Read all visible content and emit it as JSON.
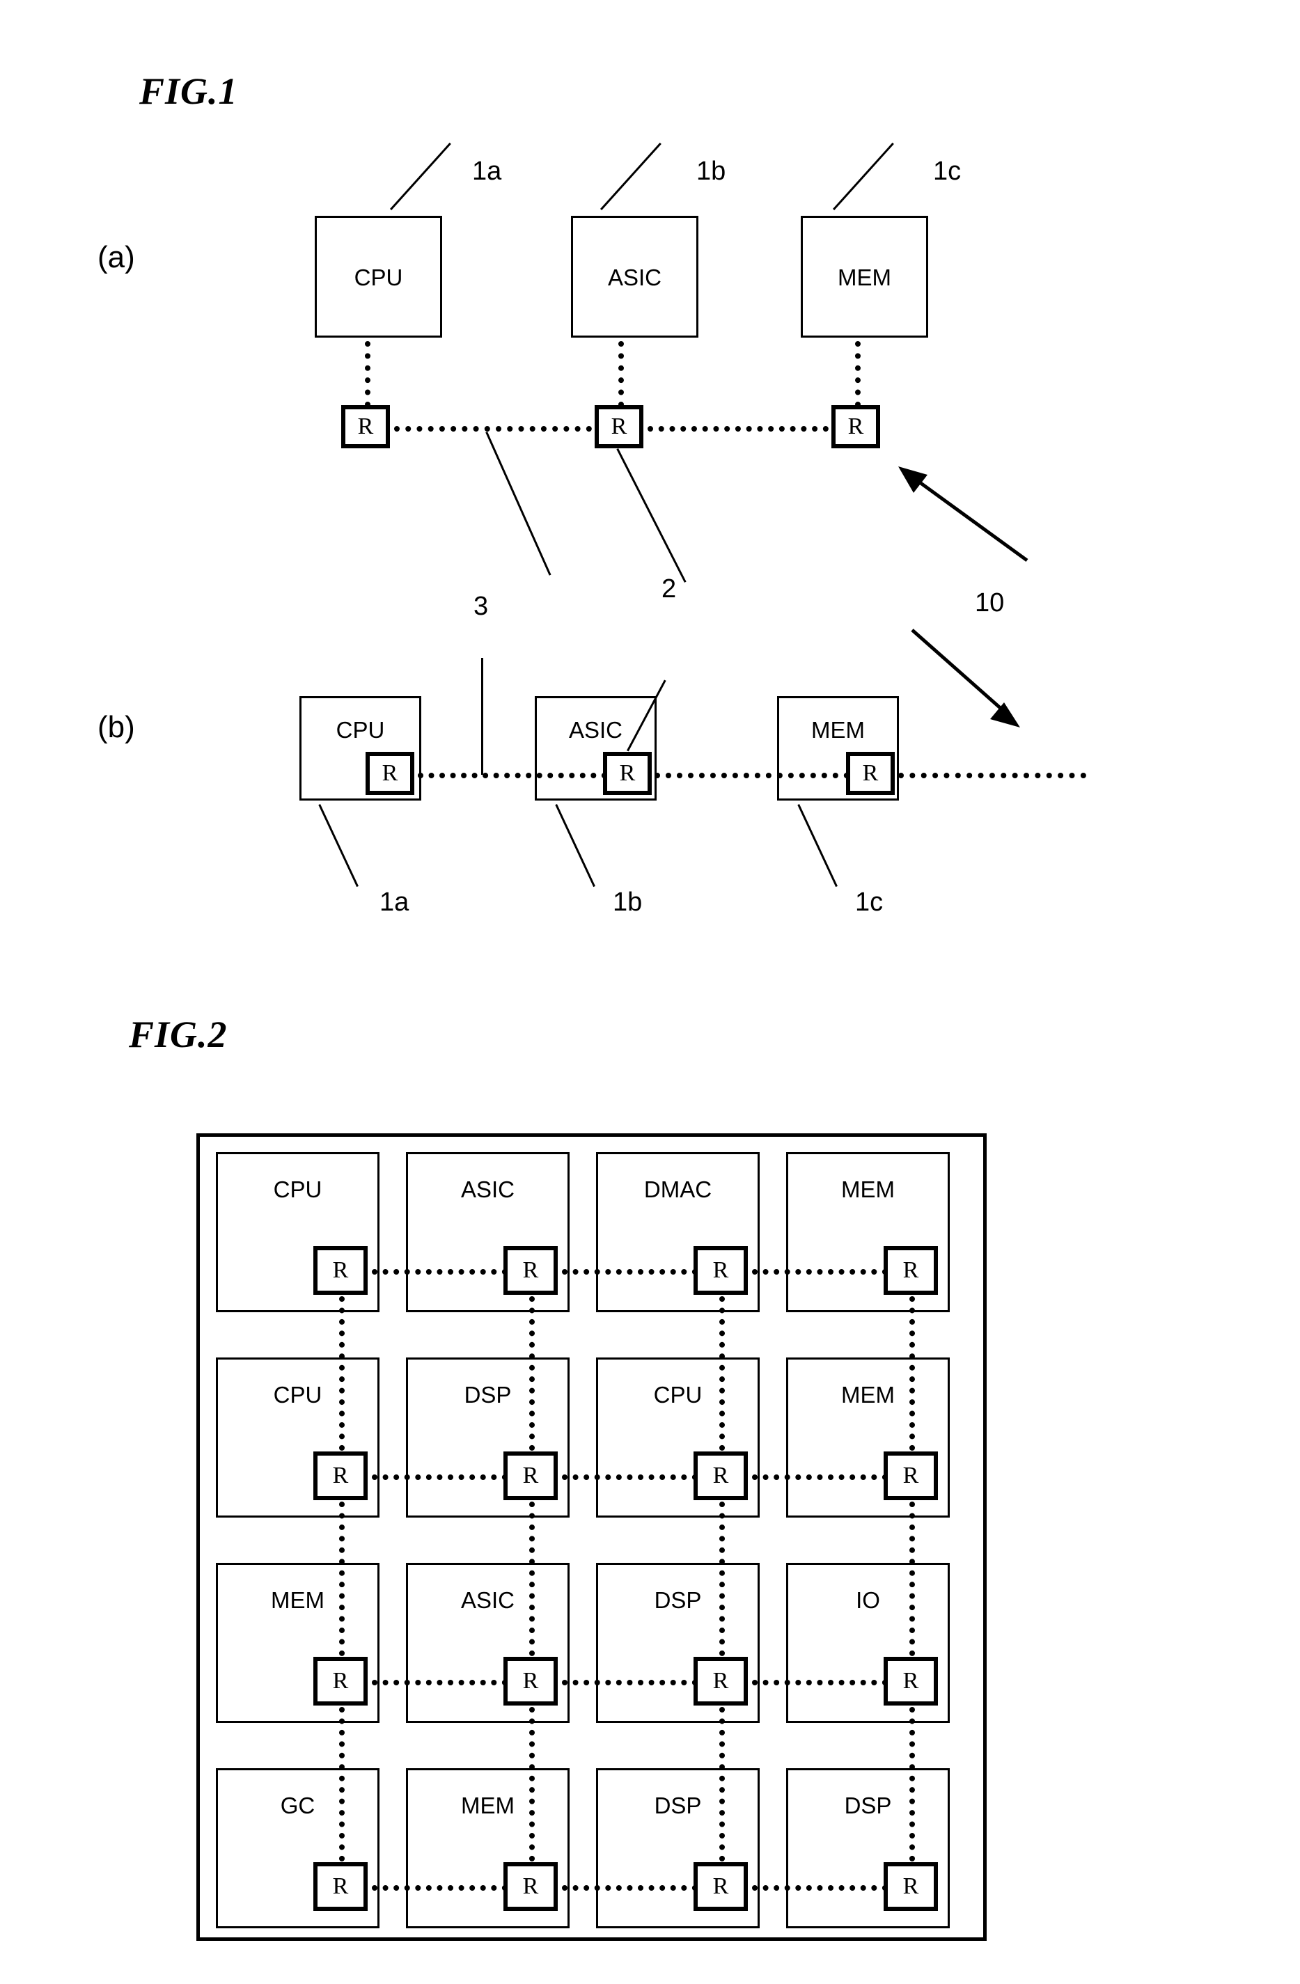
{
  "figures": {
    "fig1": {
      "title": "FIG.1",
      "panels": [
        {
          "label": "(a)"
        },
        {
          "label": "(b)"
        }
      ],
      "panel_a": {
        "blocks": [
          {
            "name": "CPU",
            "ref": "1a"
          },
          {
            "name": "ASIC",
            "ref": "1b"
          },
          {
            "name": "MEM",
            "ref": "1c"
          }
        ],
        "router_label": "R"
      },
      "panel_b": {
        "blocks": [
          {
            "name": "CPU",
            "ref": "1a"
          },
          {
            "name": "ASIC",
            "ref": "1b"
          },
          {
            "name": "MEM",
            "ref": "1c"
          }
        ],
        "router_label": "R"
      },
      "callouts": {
        "link": "3",
        "router": "2",
        "network": "10"
      }
    },
    "fig2": {
      "title": "FIG.2",
      "router_label": "R",
      "grid": [
        [
          "CPU",
          "ASIC",
          "DMAC",
          "MEM"
        ],
        [
          "CPU",
          "DSP",
          "CPU",
          "MEM"
        ],
        [
          "MEM",
          "ASIC",
          "DSP",
          "IO"
        ],
        [
          "GC",
          "MEM",
          "DSP",
          "DSP"
        ]
      ]
    }
  }
}
